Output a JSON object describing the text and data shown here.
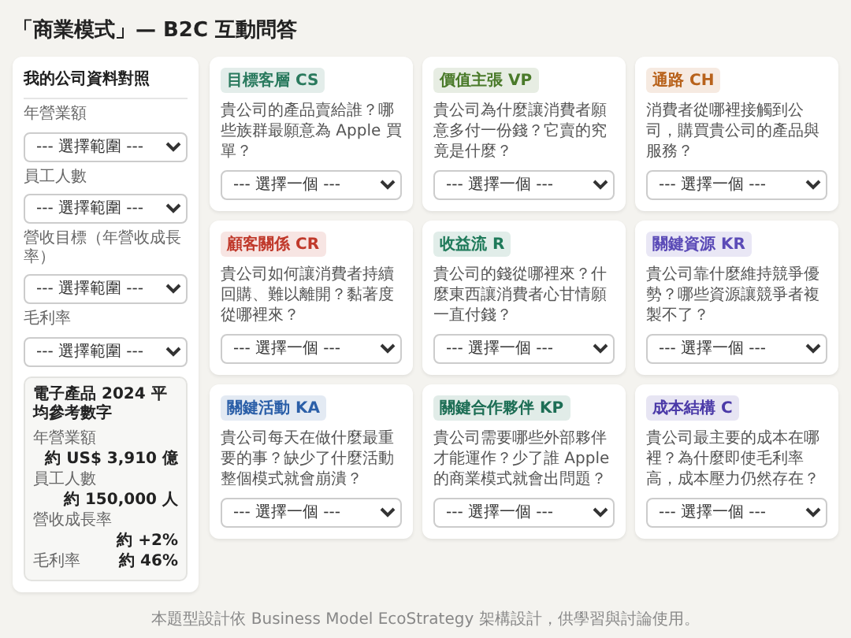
{
  "title": "「商業模式」— B2C 互動問答",
  "sidebar": {
    "title": "我的公司資料對照",
    "fields": [
      {
        "label": "年營業額",
        "value": "--- 選擇範圍 ---"
      },
      {
        "label": "員工人數",
        "value": "--- 選擇範圍 ---"
      },
      {
        "label": "營收目標（年營收成長率）",
        "value": "--- 選擇範圍 ---"
      },
      {
        "label": "毛利率",
        "value": "--- 選擇範圍 ---"
      }
    ],
    "reference": {
      "title": "電子產品 2024 平均參考數字",
      "rows": [
        {
          "label": "年營業額",
          "value": "約 US$ 3,910 億"
        },
        {
          "label": "員工人數",
          "value": "約 150,000 人"
        },
        {
          "label": "營收成長率",
          "value": "約 +2%"
        },
        {
          "label": "毛利率",
          "value": "約 46%"
        }
      ]
    }
  },
  "cards": [
    {
      "tag": "目標客層 CS",
      "color": "#2a7a5e",
      "question": "貴公司的產品賣給誰？哪些族群最願意為 Apple 買單？",
      "answer": "--- 選擇一個 ---"
    },
    {
      "tag": "價值主張 VP",
      "color": "#4a7a2a",
      "question": "貴公司為什麼讓消費者願意多付一份錢？它賣的究竟是什麼？",
      "answer": "--- 選擇一個 ---"
    },
    {
      "tag": "通路 CH",
      "color": "#b8621b",
      "question": "消費者從哪裡接觸到公司，購買貴公司的產品與服務？",
      "answer": "--- 選擇一個 ---"
    },
    {
      "tag": "顧客關係 CR",
      "color": "#c0392b",
      "question": "貴公司如何讓消費者持續回購、難以離開？黏著度從哪裡來？",
      "answer": "--- 選擇一個 ---"
    },
    {
      "tag": "收益流 R",
      "color": "#1f7a5a",
      "question": "貴公司的錢從哪裡來？什麼東西讓消費者心甘情願一直付錢？",
      "answer": "--- 選擇一個 ---"
    },
    {
      "tag": "關鍵資源 KR",
      "color": "#5b4bb7",
      "question": "貴公司靠什麼維持競爭優勢？哪些資源讓競爭者複製不了？",
      "answer": "--- 選擇一個 ---"
    },
    {
      "tag": "關鍵活動 KA",
      "color": "#2b5fa8",
      "question": "貴公司每天在做什麼最重要的事？缺少了什麼活動整個模式就會崩潰？",
      "answer": "--- 選擇一個 ---"
    },
    {
      "tag": "關鍵合作夥伴 KP",
      "color": "#1d6e55",
      "question": "貴公司需要哪些外部夥伴才能運作？少了誰 Apple 的商業模式就會出問題？",
      "answer": "--- 選擇一個 ---"
    },
    {
      "tag": "成本結構 C",
      "color": "#4b3aa8",
      "question": "貴公司最主要的成本在哪裡？為什麼即使毛利率高，成本壓力仍然存在？",
      "answer": "--- 選擇一個 ---"
    }
  ],
  "footer": "本題型設計依 Business Model EcoStrategy 架構設計，供學習與討論使用。"
}
